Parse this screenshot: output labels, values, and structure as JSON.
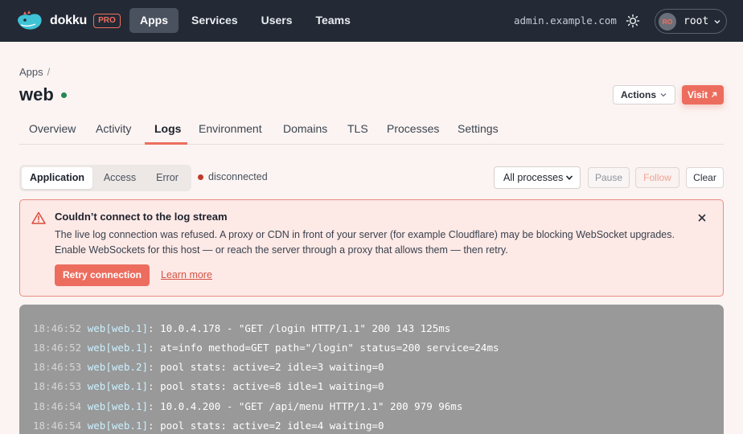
{
  "brand": {
    "name": "dokku",
    "badge": "PRO"
  },
  "nav": {
    "items": [
      {
        "label": "Apps",
        "active": true
      },
      {
        "label": "Services",
        "active": false
      },
      {
        "label": "Users",
        "active": false
      },
      {
        "label": "Teams",
        "active": false
      }
    ],
    "host": "admin.example.com",
    "user": {
      "initials": "RO",
      "name": "root"
    }
  },
  "breadcrumb": {
    "root": "Apps",
    "separator": "/"
  },
  "app": {
    "name": "web",
    "status_color": "#22884f"
  },
  "header_actions": {
    "actions_label": "Actions",
    "visit_label": "Visit"
  },
  "tabs": [
    {
      "label": "Overview",
      "active": false
    },
    {
      "label": "Activity",
      "active": false
    },
    {
      "label": "Logs",
      "active": true
    },
    {
      "label": "Environment",
      "active": false
    },
    {
      "label": "Domains",
      "active": false
    },
    {
      "label": "TLS",
      "active": false
    },
    {
      "label": "Processes",
      "active": false
    },
    {
      "label": "Settings",
      "active": false
    }
  ],
  "log_toolbar": {
    "streams": [
      {
        "label": "Application",
        "active": true
      },
      {
        "label": "Access",
        "active": false
      },
      {
        "label": "Error",
        "active": false
      }
    ],
    "connection_status": "disconnected",
    "process_filter": "All processes",
    "pause_label": "Pause",
    "follow_label": "Follow",
    "clear_label": "Clear"
  },
  "alert": {
    "title": "Couldn’t connect to the log stream",
    "body_line1": "The live log connection was refused. A proxy or CDN in front of your server (for example Cloudflare) may be blocking WebSocket upgrades.",
    "body_line2": "Enable WebSockets for this host — or reach the server through a proxy that allows them — then retry.",
    "retry_label": "Retry connection",
    "learn_more_label": "Learn more"
  },
  "logs": [
    {
      "time": "18:46:52",
      "source": "web[web.1]",
      "message": ": 10.0.4.178 - \"GET /login HTTP/1.1\" 200 143 125ms"
    },
    {
      "time": "18:46:52",
      "source": "web[web.1]",
      "message": ": at=info method=GET path=\"/login\" status=200 service=24ms"
    },
    {
      "time": "18:46:53",
      "source": "web[web.2]",
      "message": ": pool stats: active=2 idle=3 waiting=0"
    },
    {
      "time": "18:46:53",
      "source": "web[web.1]",
      "message": ": pool stats: active=8 idle=1 waiting=0"
    },
    {
      "time": "18:46:54",
      "source": "web[web.1]",
      "message": ": 10.0.4.200 - \"GET /api/menu HTTP/1.1\" 200 979 96ms"
    },
    {
      "time": "18:46:54",
      "source": "web[web.1]",
      "message": ": pool stats: active=2 idle=4 waiting=0"
    }
  ],
  "colors": {
    "accent": "#ec6d5e",
    "nav_bg": "#232a35",
    "log_bg": "#999999"
  },
  "icons": {
    "theme": "sun-icon",
    "alert": "warning-triangle-icon",
    "close": "close-icon",
    "visit": "external-link-icon"
  }
}
